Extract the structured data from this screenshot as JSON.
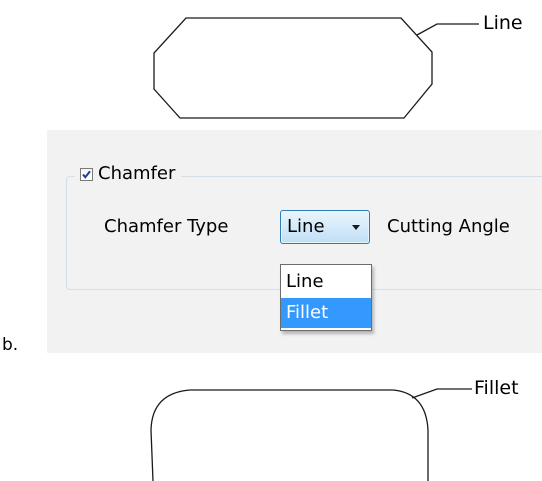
{
  "top_figure": {
    "callout_label": "Line"
  },
  "dialog": {
    "group_checkbox_label": "Chamfer",
    "group_checkbox_checked": true,
    "chamfer_type_label": "Chamfer Type",
    "chamfer_type_value": "Line",
    "cutting_angle_label": "Cutting Angle",
    "dropdown_options": [
      "Line",
      "Fillet"
    ],
    "highlighted_option": "Fillet",
    "highlight_color": "#3399ff",
    "combo_border_color": "#2f7db8",
    "dropdown_arrow_icon": "triangle-down-icon",
    "check_icon": "checkmark-icon"
  },
  "sublabel": "b.",
  "bottom_figure": {
    "callout_label": "Fillet"
  }
}
